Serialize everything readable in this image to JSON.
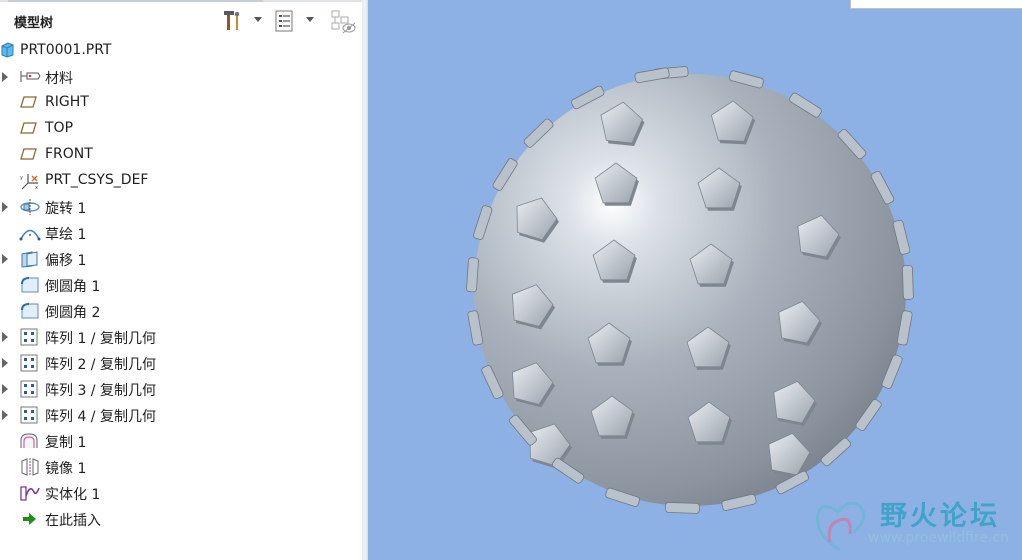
{
  "model_tree": {
    "title": "模型树",
    "header_icons": [
      "settings-tools-icon",
      "tree-filter-icon",
      "show-hide-icon"
    ],
    "items": [
      {
        "label": "PRT0001.PRT",
        "icon": "part-icon",
        "expandable": false
      },
      {
        "label": "材料",
        "icon": "material-icon",
        "expandable": true
      },
      {
        "label": "RIGHT",
        "icon": "datum-plane-icon",
        "expandable": false
      },
      {
        "label": "TOP",
        "icon": "datum-plane-icon",
        "expandable": false
      },
      {
        "label": "FRONT",
        "icon": "datum-plane-icon",
        "expandable": false
      },
      {
        "label": "PRT_CSYS_DEF",
        "icon": "csys-icon",
        "expandable": false
      },
      {
        "label": "旋转 1",
        "icon": "revolve-icon",
        "expandable": true
      },
      {
        "label": "草绘 1",
        "icon": "sketch-icon",
        "expandable": false
      },
      {
        "label": "偏移 1",
        "icon": "offset-icon",
        "expandable": true
      },
      {
        "label": "倒圆角 1",
        "icon": "round-icon",
        "expandable": false
      },
      {
        "label": "倒圆角 2",
        "icon": "round-icon",
        "expandable": false
      },
      {
        "label": "阵列 1 / 复制几何",
        "icon": "pattern-icon",
        "expandable": true
      },
      {
        "label": "阵列 2 / 复制几何",
        "icon": "pattern-icon",
        "expandable": true
      },
      {
        "label": "阵列 3 / 复制几何",
        "icon": "pattern-icon",
        "expandable": true
      },
      {
        "label": "阵列 4 / 复制几何",
        "icon": "pattern-icon",
        "expandable": true
      },
      {
        "label": "复制 1",
        "icon": "copy-icon",
        "expandable": false
      },
      {
        "label": "镜像 1",
        "icon": "mirror-icon",
        "expandable": false
      },
      {
        "label": "实体化 1",
        "icon": "solidify-icon",
        "expandable": false
      },
      {
        "label": "在此插入",
        "icon": "insert-here-icon",
        "expandable": false
      }
    ]
  },
  "watermark": {
    "title": "野火论坛",
    "url": "www.proewildfire.cn"
  },
  "colors": {
    "viewport_bg": "#8db1e4",
    "sphere": "#a7b0ba",
    "insert_arrow": "#1a8f1a"
  }
}
